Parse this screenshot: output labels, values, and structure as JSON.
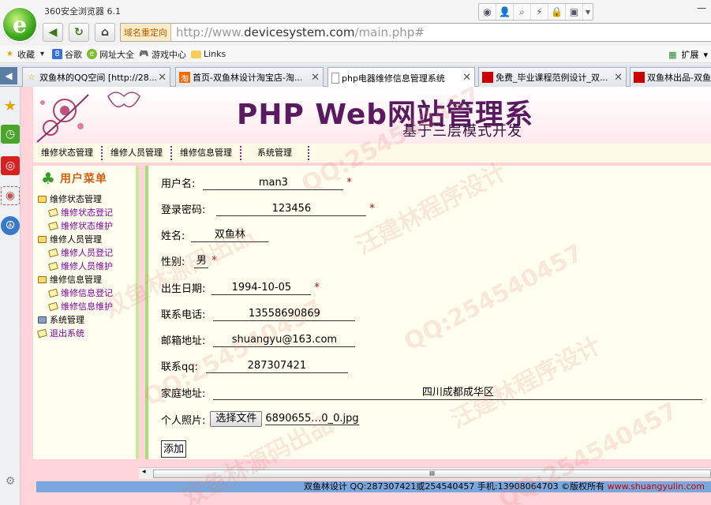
{
  "browser": {
    "app_title": "360安全浏览器 6.1",
    "logo_letter": "e",
    "address_tag": "域名重定向",
    "url_prefix": "http://www.",
    "url_host": "devicesystem.com",
    "url_path": "/main.php#",
    "bookmarks": [
      "收藏",
      "谷歌",
      "网址大全",
      "游戏中心",
      "Links"
    ],
    "ext_label": "扩展",
    "tabs": [
      {
        "label": "双鱼林的QQ空间 [http://28...",
        "active": false
      },
      {
        "label": "首页-双鱼林设计淘宝店-淘...",
        "active": false
      },
      {
        "label": "php电器维修信息管理系统",
        "active": true
      },
      {
        "label": "免费_毕业课程范例设计_双...",
        "active": false
      },
      {
        "label": "双鱼林出品-双鱼",
        "active": false
      }
    ]
  },
  "banner": {
    "title": "PHP Web网站管理系",
    "subtitle": "基于三层模式开发"
  },
  "top_menu": [
    "维修状态管理",
    "维修人员管理",
    "维修信息管理",
    "系统管理"
  ],
  "left_menu": {
    "heading": "用户菜单",
    "groups": [
      {
        "label": "维修状态管理",
        "items": [
          "维修状态登记",
          "维修状态维护"
        ]
      },
      {
        "label": "维修人员管理",
        "items": [
          "维修人员登记",
          "维修人员维护"
        ]
      },
      {
        "label": "维修信息管理",
        "items": [
          "维修信息登记",
          "维修信息维护"
        ]
      }
    ],
    "system": "系统管理",
    "logout": "退出系统"
  },
  "form": {
    "username_label": "用户名:",
    "username": "man3",
    "password_label": "登录密码:",
    "password": "123456",
    "name_label": "姓名:",
    "name": "双鱼林",
    "gender_label": "性别:",
    "gender": "男",
    "birthday_label": "出生日期:",
    "birthday": "1994-10-05",
    "phone_label": "联系电话:",
    "phone": "13558690869",
    "email_label": "邮箱地址:",
    "email": "shuangyu@163.com",
    "qq_label": "联系qq:",
    "qq": "287307421",
    "address_label": "家庭地址:",
    "address": "四川成都成华区",
    "photo_label": "个人照片:",
    "file_button": "选择文件",
    "file_name": "6890655…0_0.jpg",
    "required_mark": "*",
    "submit": "添加"
  },
  "scroll_grip": "III",
  "footer": {
    "text": "双鱼林设计 QQ:287307421或254540457 手机:13908064703 ©版权所有 ",
    "link": "www.shuangyulin.com"
  },
  "watermarks": [
    "QQ:254540457",
    "汪建林程序设计",
    "双鱼林源码出品"
  ],
  "colors": {
    "accent": "#7a2a9a",
    "required": "#cc0000",
    "page_bg": "#ffd4da",
    "form_bg": "#fffff0"
  }
}
